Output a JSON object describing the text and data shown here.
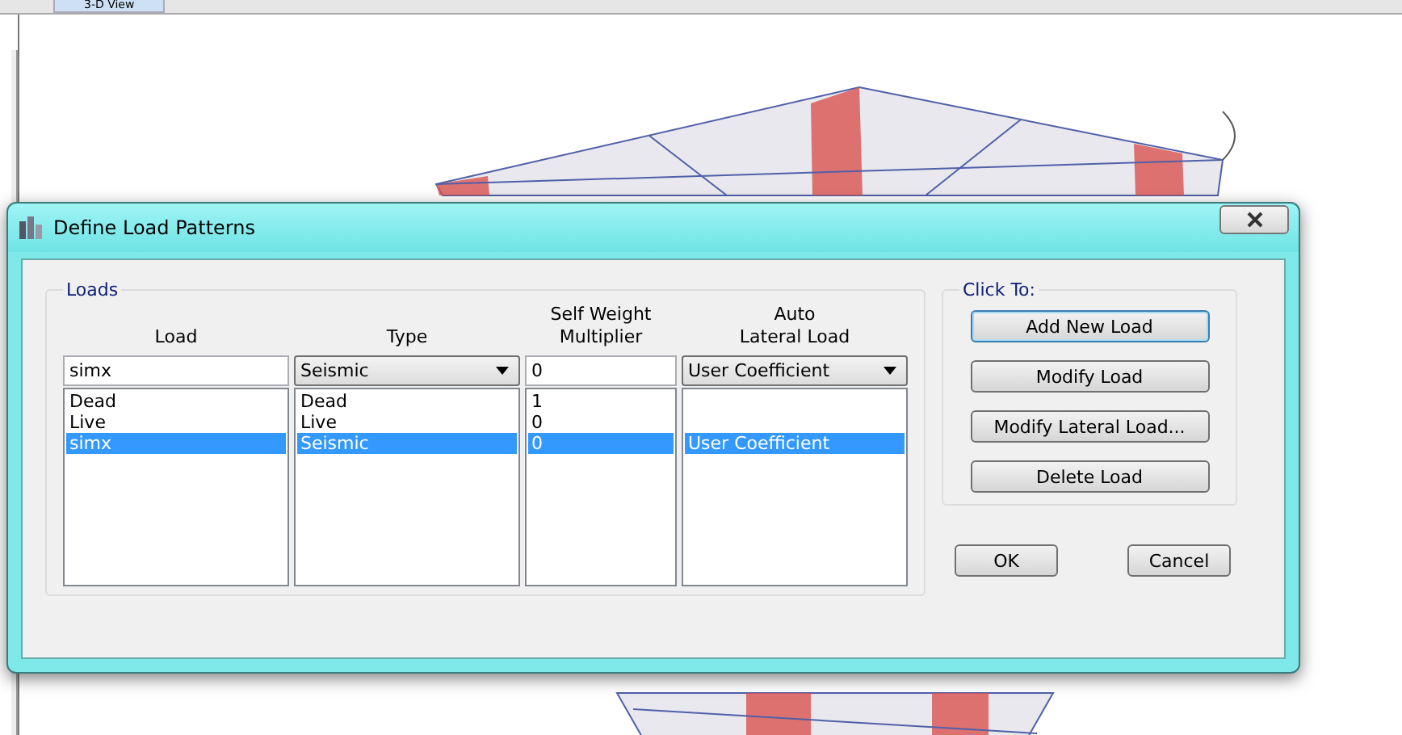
{
  "view_tab": {
    "label": "3-D View",
    "selected": true
  },
  "dialog": {
    "title": "Define Load Patterns",
    "loads": {
      "title": "Loads",
      "columns": [
        {
          "heading": "Load",
          "kind": "text",
          "value": "simx"
        },
        {
          "heading": "Type",
          "kind": "combo",
          "value": "Seismic"
        },
        {
          "heading": "Self Weight\nMultiplier",
          "kind": "text",
          "value": "0"
        },
        {
          "heading": "Auto\nLateral Load",
          "kind": "combo",
          "value": "User Coefficient"
        }
      ],
      "rows": [
        {
          "cells": [
            "Dead",
            "Dead",
            "1"
          ],
          "selected": false
        },
        {
          "cells": [
            "Live",
            "Live",
            "0"
          ],
          "selected": false
        },
        {
          "cells": [
            "simx",
            "Seismic",
            "0",
            "User Coefficient"
          ],
          "selected": true
        }
      ]
    },
    "click_to": {
      "title": "Click To:",
      "buttons": [
        {
          "label": "Add New Load",
          "focused": true
        },
        {
          "label": "Modify Load",
          "focused": false
        },
        {
          "label": "Modify Lateral Load...",
          "focused": false
        },
        {
          "label": "Delete Load",
          "focused": false
        }
      ]
    },
    "buttons": [
      {
        "label": "OK"
      },
      {
        "label": "Cancel"
      }
    ]
  }
}
